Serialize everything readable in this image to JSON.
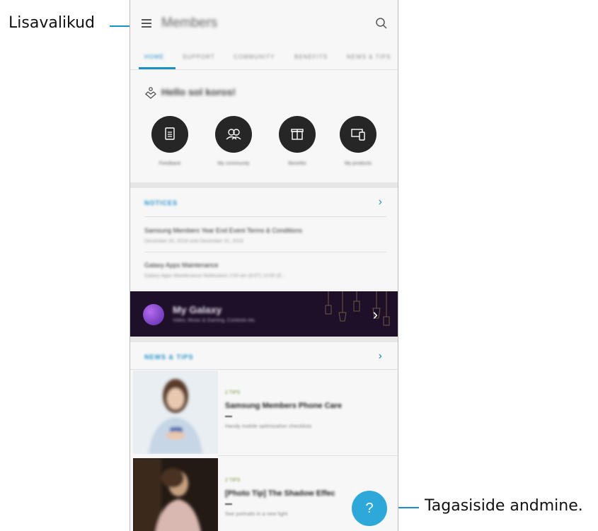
{
  "callouts": {
    "menu_label": "Lisavalikud",
    "feedback_label": "Tagasiside andmine."
  },
  "appbar": {
    "title": "Members",
    "menu_icon": "menu-icon",
    "search_icon": "search-icon"
  },
  "tabs": [
    {
      "label": "HOME",
      "active": true
    },
    {
      "label": "SUPPORT"
    },
    {
      "label": "COMMUNITY"
    },
    {
      "label": "BENEFITS"
    },
    {
      "label": "NEWS & TIPS"
    }
  ],
  "greeting": "Hello sol koros!",
  "quick_actions": [
    {
      "label": "Feedback",
      "icon": "document-icon"
    },
    {
      "label": "My community",
      "icon": "community-icon"
    },
    {
      "label": "Benefits",
      "icon": "gift-icon"
    },
    {
      "label": "My products",
      "icon": "devices-icon"
    }
  ],
  "notices": {
    "header": "NOTICES",
    "items": [
      {
        "title": "Samsung Members Year End Event Terms & Conditions",
        "sub": "December 20, 2018 until December 31, 2018"
      },
      {
        "title": "Galaxy Apps Maintenance",
        "sub": "Galaxy Apps Maintenance Notification 2:00 am (KST) 10:00 (E.."
      }
    ]
  },
  "banner": {
    "title": "My Galaxy",
    "subtitle": "Video, Music & Gaming, Contests etc."
  },
  "news": {
    "header": "NEWS & TIPS",
    "cards": [
      {
        "tag": "2 TIPS",
        "title": "Samsung Members Phone Care",
        "sub": "Handy mobile optimization checklists"
      },
      {
        "tag": "2 TIPS",
        "title": "[Photo Tip] The Shadow Effec",
        "sub": "See portraits in a new light"
      }
    ]
  },
  "fab": {
    "label": "?"
  },
  "colors": {
    "accent": "#1e8fc6",
    "fab": "#2da8d8",
    "banner_bg": "#1d1028",
    "action_circle": "#262626"
  }
}
